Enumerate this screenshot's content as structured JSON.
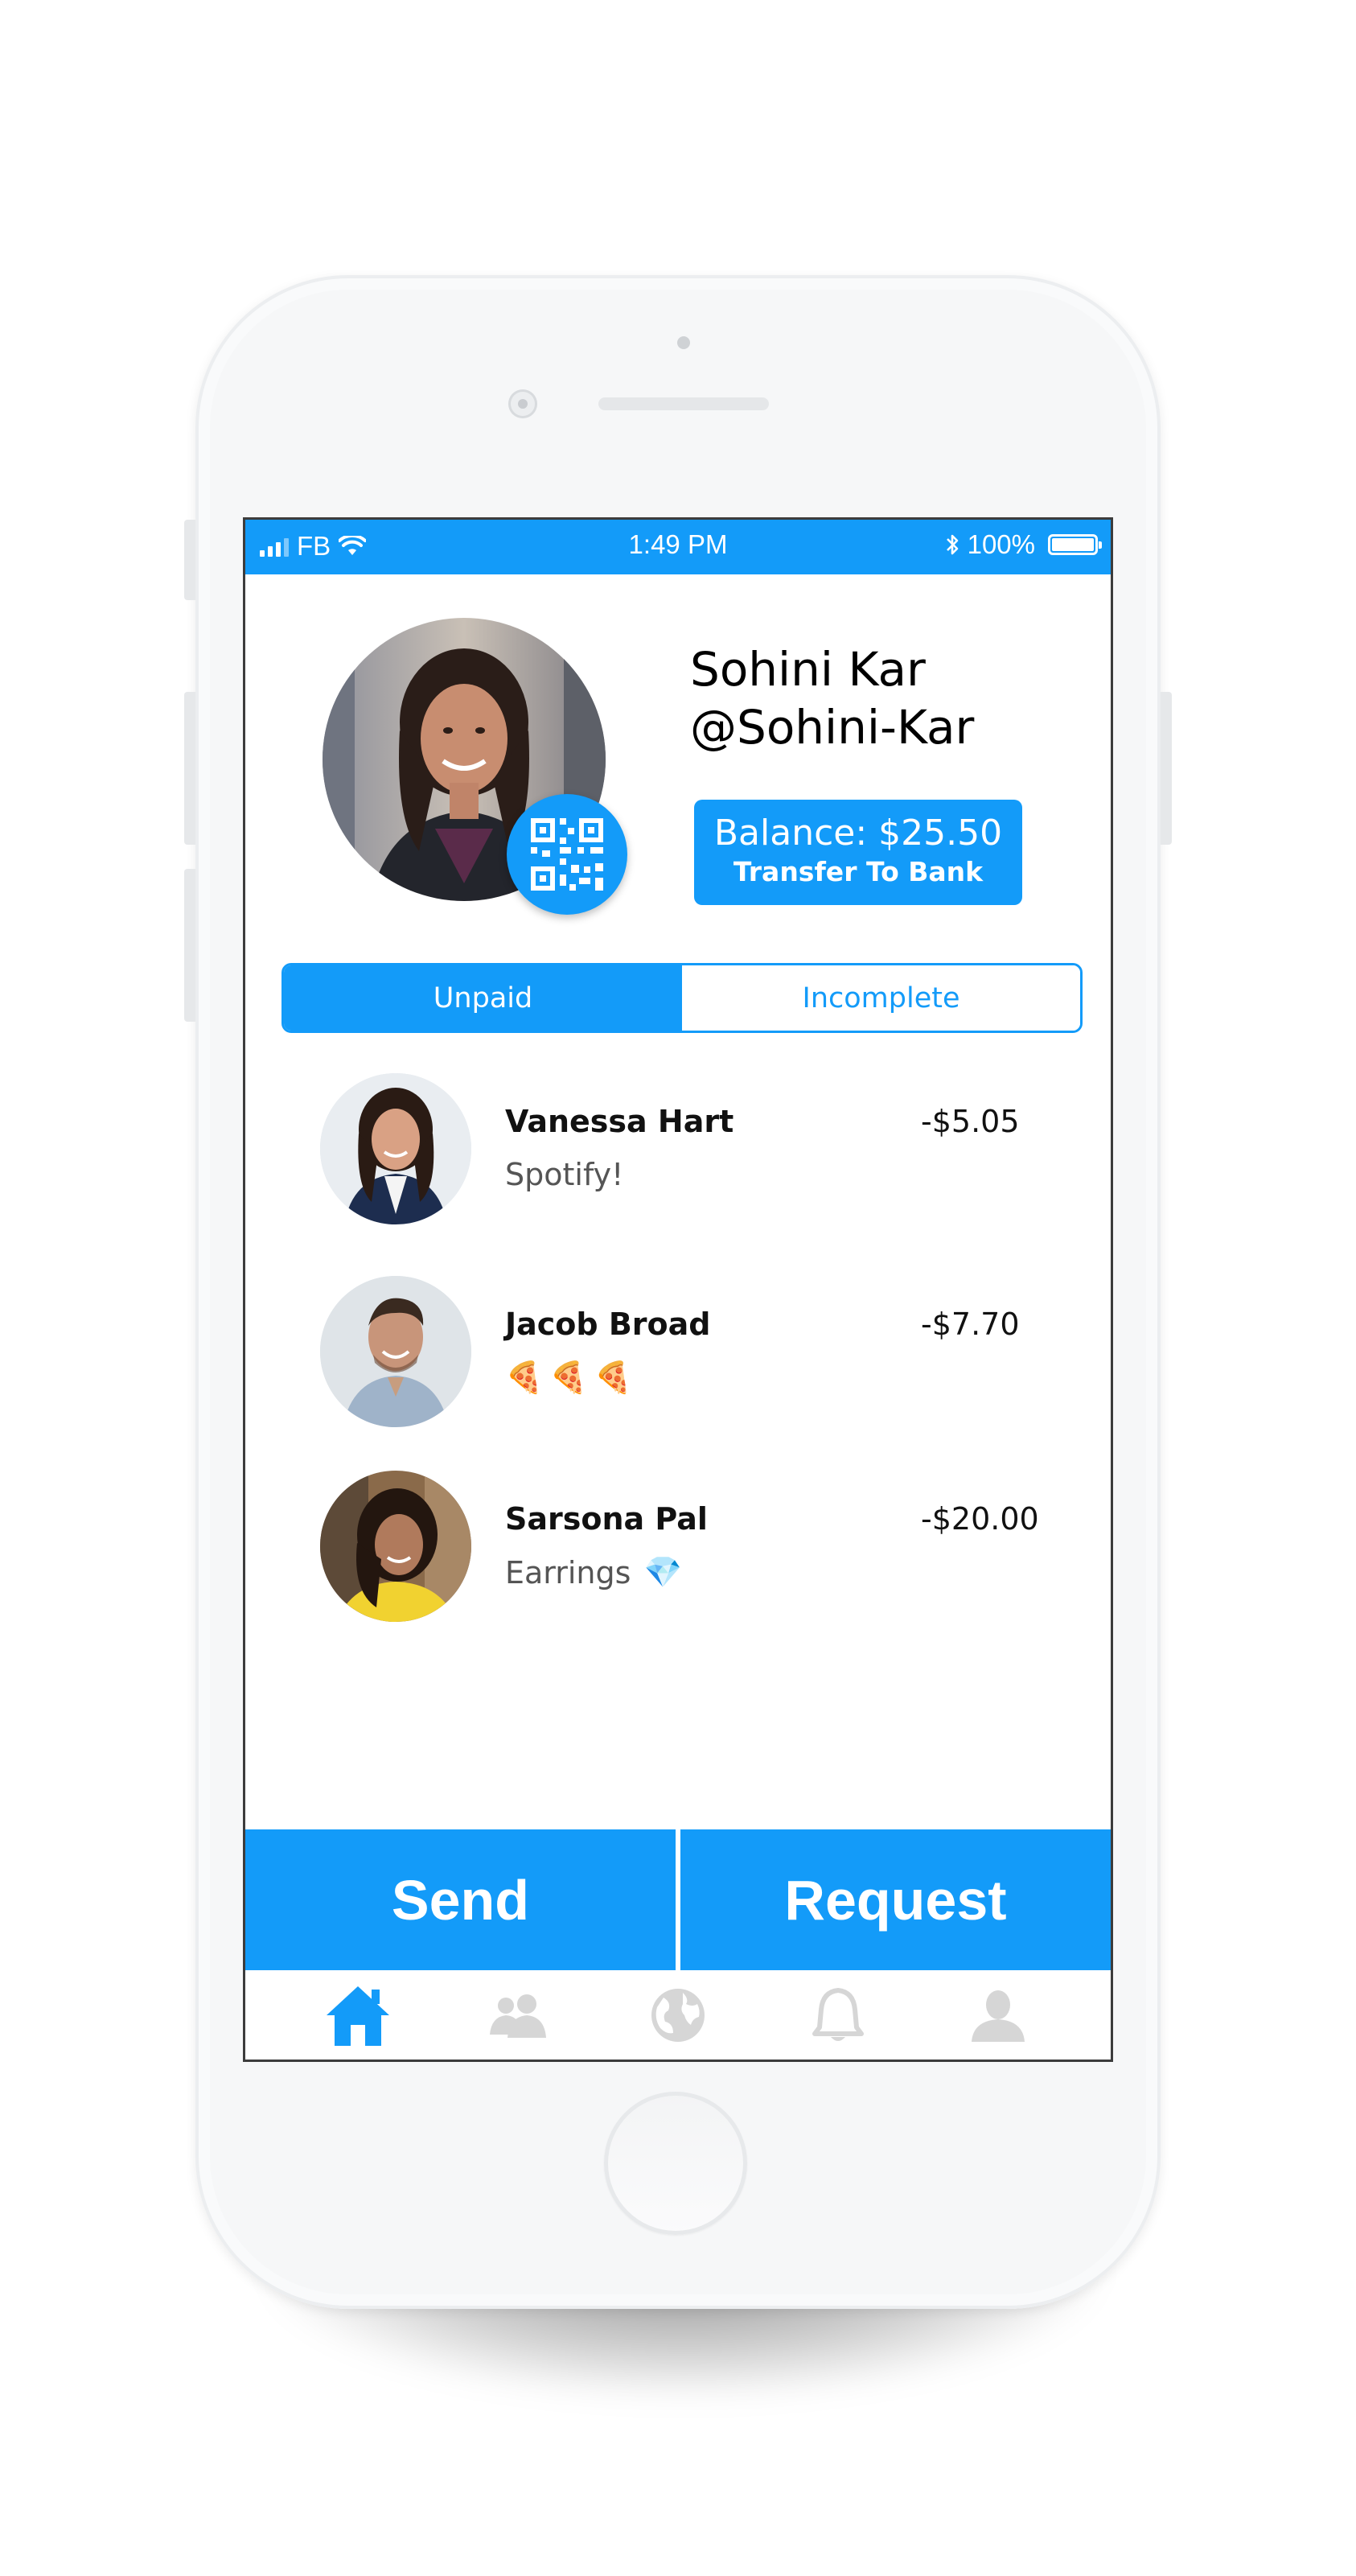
{
  "status_bar": {
    "carrier": "FB",
    "time": "1:49 PM",
    "battery": "100%"
  },
  "profile": {
    "name": "Sohini Kar",
    "handle": "@Sohini-Kar",
    "balance_label": "Balance: $25.50",
    "transfer_label": "Transfer To Bank"
  },
  "tabs": {
    "unpaid": "Unpaid",
    "incomplete": "Incomplete",
    "active": "Unpaid"
  },
  "transactions": [
    {
      "name": "Vanessa Hart",
      "note": "Spotify!",
      "emoji": "",
      "amount": "-$5.05"
    },
    {
      "name": "Jacob Broad",
      "note": "",
      "emoji": "🍕🍕🍕",
      "amount": "-$7.70"
    },
    {
      "name": "Sarsona Pal",
      "note": "Earrings",
      "emoji": "💎",
      "amount": "-$20.00"
    }
  ],
  "actions": {
    "send": "Send",
    "request": "Request"
  },
  "nav": [
    {
      "icon": "home-icon",
      "active": true
    },
    {
      "icon": "friends-icon",
      "active": false
    },
    {
      "icon": "globe-icon",
      "active": false
    },
    {
      "icon": "bell-icon",
      "active": false
    },
    {
      "icon": "profile-icon",
      "active": false
    }
  ],
  "colors": {
    "accent": "#139bf9",
    "inactive_icon": "#d6d6d6"
  }
}
